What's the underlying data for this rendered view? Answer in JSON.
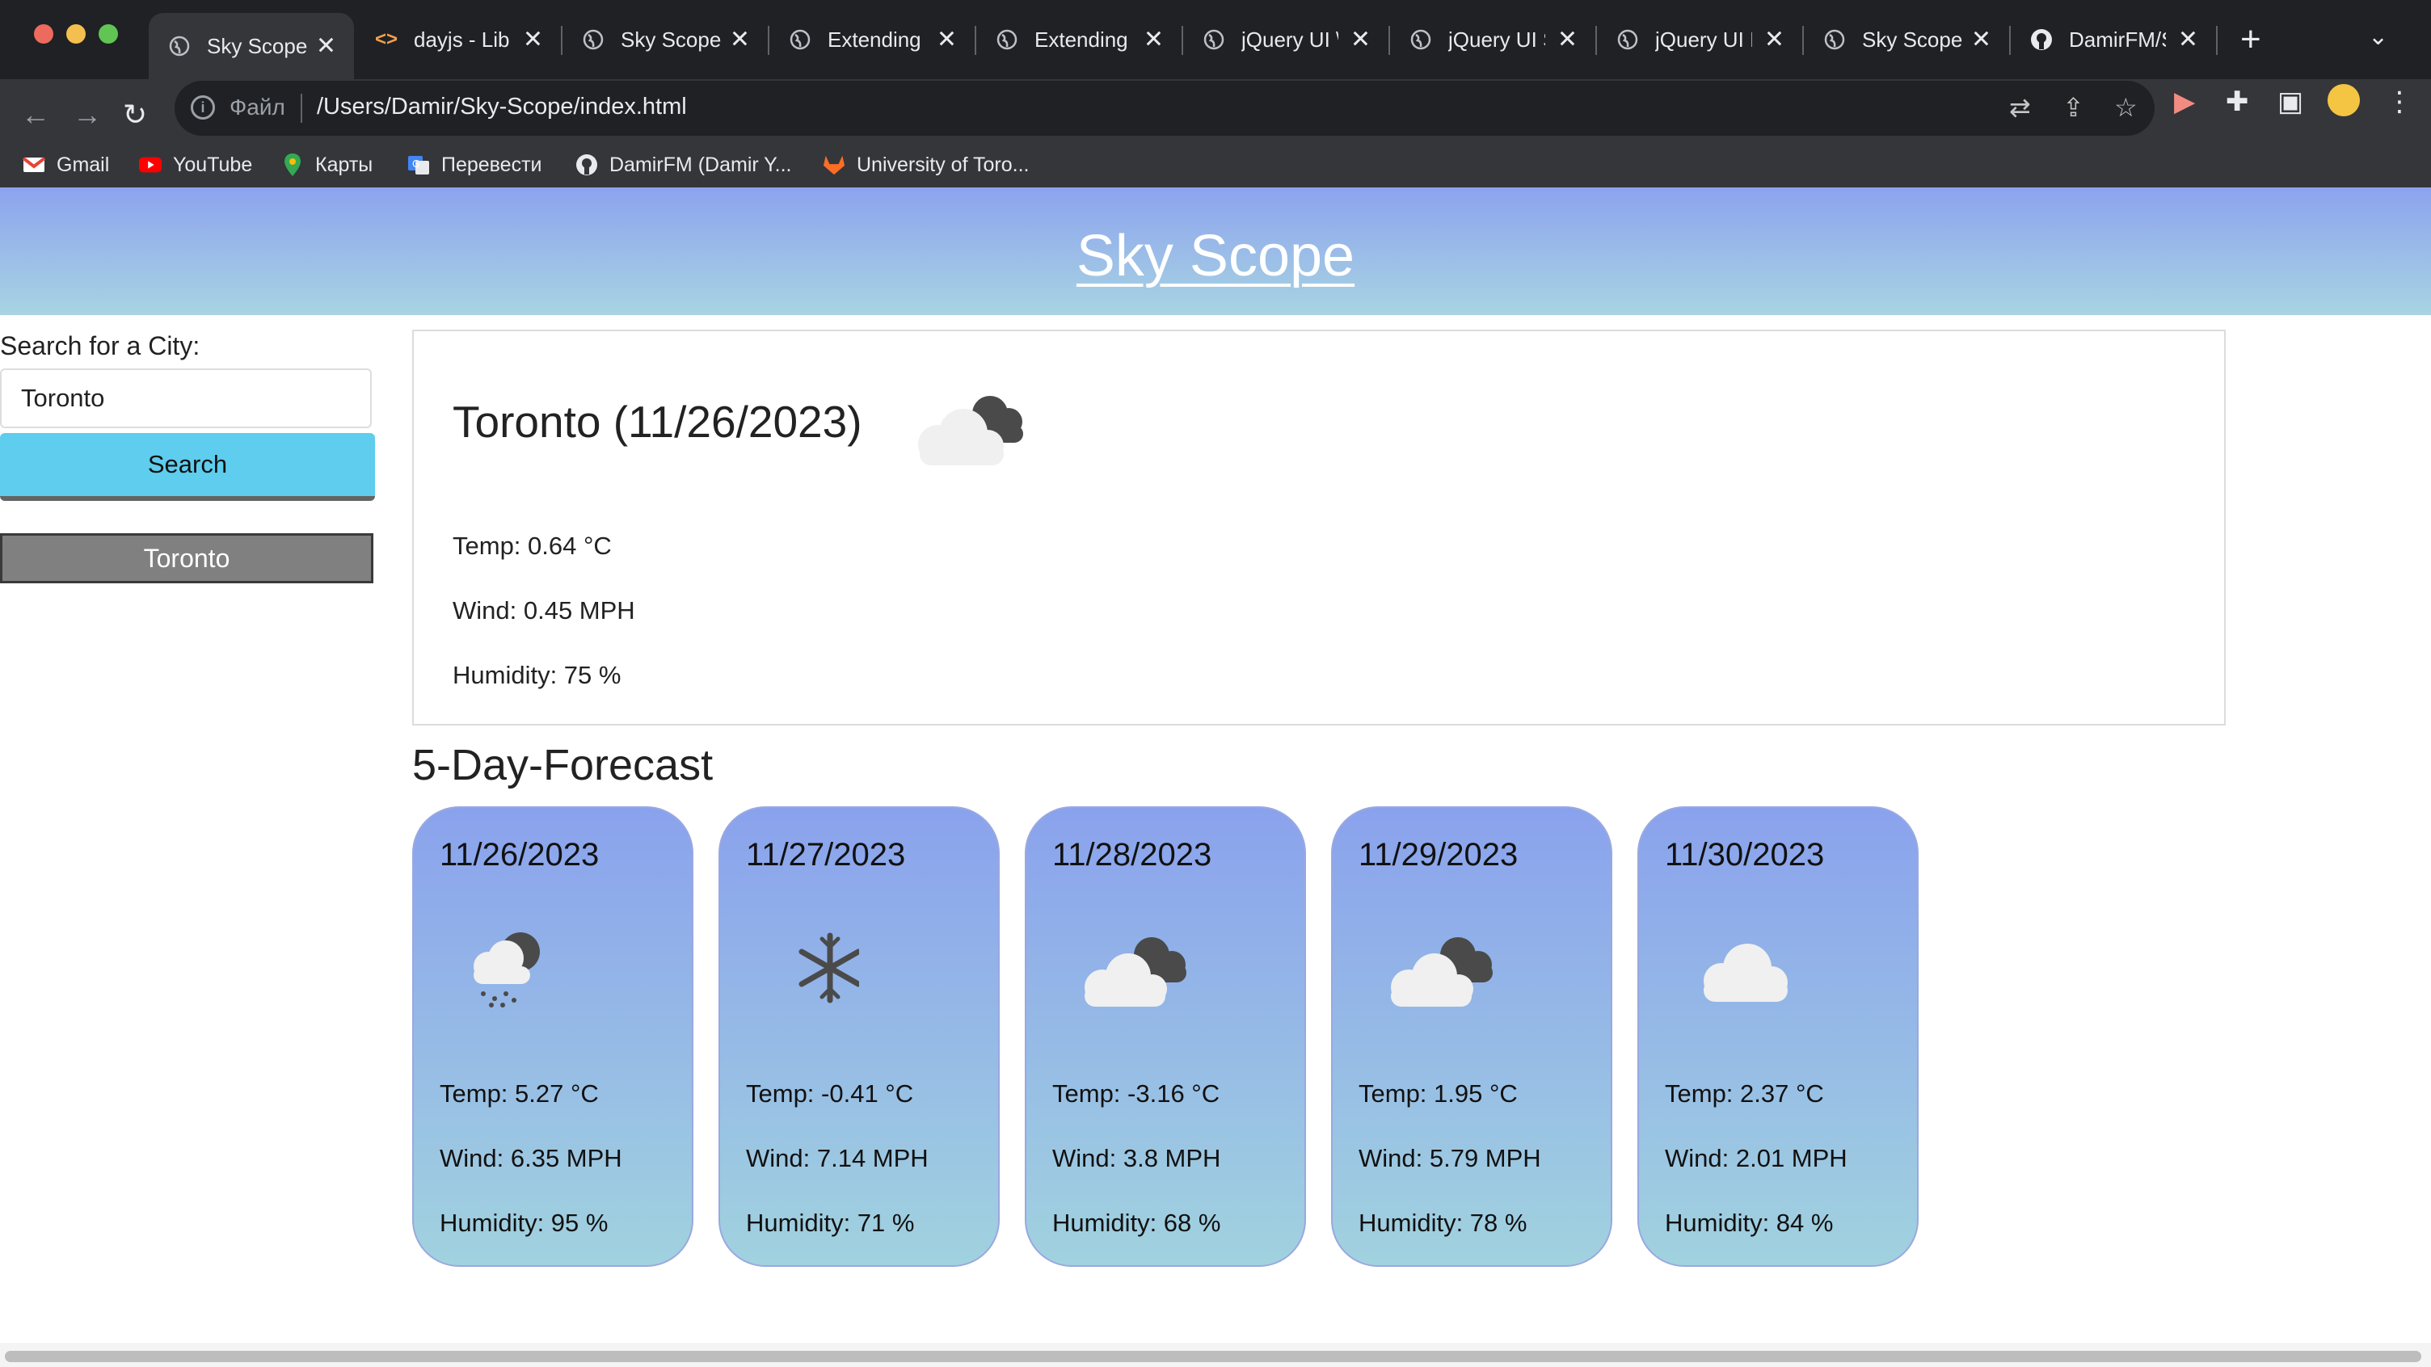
{
  "browser": {
    "tabs": [
      {
        "title": "Sky Scope",
        "icon": "globe-icon",
        "active": true
      },
      {
        "title": "dayjs - Lib",
        "icon": "code-icon",
        "active": false
      },
      {
        "title": "Sky Scope",
        "icon": "globe-icon",
        "active": false
      },
      {
        "title": "Extending",
        "icon": "globe-icon",
        "active": false
      },
      {
        "title": "Extending",
        "icon": "globe-icon",
        "active": false
      },
      {
        "title": "jQuery UI \\",
        "icon": "globe-icon",
        "active": false
      },
      {
        "title": "jQuery UI S",
        "icon": "globe-icon",
        "active": false
      },
      {
        "title": "jQuery UI I",
        "icon": "globe-icon",
        "active": false
      },
      {
        "title": "Sky Scope",
        "icon": "globe-icon",
        "active": false
      },
      {
        "title": "DamirFM/S",
        "icon": "github-icon",
        "active": false
      }
    ],
    "new_tab": "+",
    "address": {
      "scheme_label": "Файл",
      "url": "/Users/Damir/Sky-Scope/index.html"
    },
    "bookmarks": [
      {
        "label": "Gmail",
        "icon": "gmail-icon"
      },
      {
        "label": "YouTube",
        "icon": "youtube-icon"
      },
      {
        "label": "Карты",
        "icon": "maps-icon"
      },
      {
        "label": "Перевести",
        "icon": "translate-icon"
      },
      {
        "label": "DamirFM (Damir Y...",
        "icon": "github-icon"
      },
      {
        "label": "University of Toro...",
        "icon": "gitlab-icon"
      }
    ],
    "colors": {
      "tabstrip": "#1f2124",
      "toolbar": "#35363a"
    }
  },
  "app": {
    "title": "Sky Scope",
    "search": {
      "label": "Search for a City:",
      "value": "Toronto",
      "button_label": "Search"
    },
    "history": [
      "Toronto"
    ],
    "current": {
      "heading": "Toronto (11/26/2023)",
      "icon": "partly-cloudy-icon",
      "temp": "Temp: 0.64 °C",
      "wind": "Wind: 0.45 MPH",
      "humidity": "Humidity: 75 %"
    },
    "forecast_title": "5-Day-Forecast",
    "forecast": [
      {
        "date": "11/26/2023",
        "icon": "rain-snow-icon",
        "temp": "Temp: 5.27 °C",
        "wind": "Wind: 6.35 MPH",
        "humidity": "Humidity: 95 %"
      },
      {
        "date": "11/27/2023",
        "icon": "snowflake-icon",
        "temp": "Temp: -0.41 °C",
        "wind": "Wind: 7.14 MPH",
        "humidity": "Humidity: 71 %"
      },
      {
        "date": "11/28/2023",
        "icon": "broken-clouds-icon",
        "temp": "Temp: -3.16 °C",
        "wind": "Wind: 3.8 MPH",
        "humidity": "Humidity: 68 %"
      },
      {
        "date": "11/29/2023",
        "icon": "broken-clouds-icon",
        "temp": "Temp: 1.95 °C",
        "wind": "Wind: 5.79 MPH",
        "humidity": "Humidity: 78 %"
      },
      {
        "date": "11/30/2023",
        "icon": "cloud-icon",
        "temp": "Temp: 2.37 °C",
        "wind": "Wind: 2.01 MPH",
        "humidity": "Humidity: 84 %"
      }
    ],
    "colors": {
      "header_gradient_top": "#8ca3ee",
      "header_gradient_bottom": "#a8d4e2",
      "search_button": "#5ecdee",
      "history_button": "#808080"
    }
  }
}
